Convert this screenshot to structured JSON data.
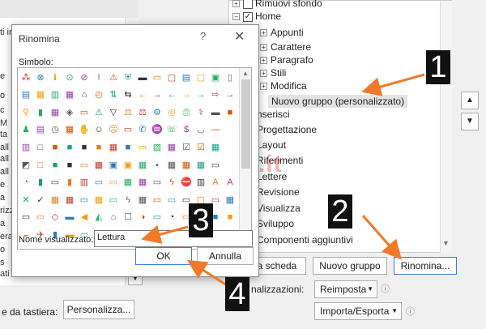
{
  "left_panel": {
    "clipped_text": [
      "ti in",
      "e",
      "o",
      "c",
      "M",
      "ta",
      "all",
      "all",
      "all",
      "e",
      "a",
      "rizz",
      "a",
      "era",
      "o",
      "s",
      "ati"
    ]
  },
  "tree": {
    "rows": [
      {
        "label": "Rimuovi sfondo",
        "expander": "+",
        "checkbox": ""
      },
      {
        "label": "Home",
        "expander": "−",
        "checkbox": "✓"
      },
      {
        "label": "Appunti",
        "expander": "+",
        "checkbox": ""
      },
      {
        "label": "Carattere",
        "expander": "+",
        "checkbox": ""
      },
      {
        "label": "Paragrafo",
        "expander": "+",
        "checkbox": ""
      },
      {
        "label": "Stili",
        "expander": "+",
        "checkbox": ""
      },
      {
        "label": "Modifica",
        "expander": "+",
        "checkbox": ""
      },
      {
        "label": "Nuovo gruppo (personalizzato)",
        "expander": "",
        "checkbox": ""
      },
      {
        "label": "nserisci",
        "expander": "",
        "checkbox": ""
      },
      {
        "label": "Progettazione",
        "expander": "",
        "checkbox": ""
      },
      {
        "label": "Layout",
        "expander": "",
        "checkbox": ""
      },
      {
        "label": "Riferimenti",
        "expander": "",
        "checkbox": ""
      },
      {
        "label": "Lettere",
        "expander": "",
        "checkbox": ""
      },
      {
        "label": "Revisione",
        "expander": "",
        "checkbox": ""
      },
      {
        "label": "Visualizza",
        "expander": "",
        "checkbox": ""
      },
      {
        "label": "Sviluppo",
        "expander": "",
        "checkbox": ""
      },
      {
        "label": "Componenti aggiuntivi",
        "expander": "",
        "checkbox": ""
      }
    ]
  },
  "buttons": {
    "new_tab": "a scheda",
    "new_group": "Nuovo gruppo",
    "rename": "Rinomina...",
    "reset": "Reimposta",
    "import_export": "Importa/Esporta",
    "customize": "Personalizza...",
    "move_up": "▲",
    "move_down": "▼"
  },
  "labels": {
    "customizations": "nalizzazioni:",
    "keyboard": "e da tastiera:",
    "info": "ⓘ"
  },
  "dialog": {
    "title": "Rinomina",
    "help": "?",
    "close": "✕",
    "symbol_label": "Simbolo:",
    "display_name_label": "Nome visualizzato:",
    "display_name_value": "Lettura",
    "ok": "OK",
    "cancel": "Annulla"
  },
  "callouts": [
    "1",
    "2",
    "3",
    "4"
  ],
  "watermark": "techpedia.it",
  "colors": {
    "arrow": "#f07a2a",
    "callout_bg": "#111111",
    "selection": "#e3e3e3"
  },
  "icon_rows": [
    [
      "⁂",
      "⊗",
      "ℹ",
      "⊙",
      "⊘",
      "!",
      "⚠",
      "⛨",
      "▬",
      "▭",
      "▢",
      "▤",
      "▢",
      "▣",
      "▯",
      "☐"
    ],
    [
      "▤",
      "▦",
      "▥",
      "▦",
      "⌂",
      "◴",
      "⇅",
      "⇆",
      "←",
      "→",
      "←",
      "→",
      "→",
      "⇨",
      "→",
      "☐"
    ],
    [
      "⚲",
      "▮",
      "▦",
      "◈",
      "▭",
      "⚠",
      "▽",
      "⚖",
      "⚖",
      "⚙",
      "◎",
      "⎙",
      "⚕",
      "▬",
      "■",
      "☐"
    ],
    [
      "♟",
      "▤",
      "◷",
      "▦",
      "✋",
      "☺",
      "☹",
      "▭",
      "✆",
      "♒",
      "☏",
      "$",
      "◡",
      "—",
      "",
      ""
    ],
    [
      "▥",
      "□",
      "■",
      "■",
      "■",
      "■",
      "▦",
      "■",
      "▭",
      "▨",
      "▦",
      "☑",
      "☑",
      "▦",
      "",
      ""
    ],
    [
      "◩",
      "□",
      "■",
      "■",
      "▭",
      "▦",
      "▣",
      "▣",
      "▦",
      "▪",
      "▦",
      "▦",
      "▦",
      "▭",
      "",
      ""
    ],
    [
      "◔",
      "▮",
      "▭",
      "▮",
      "▥",
      "▭",
      "▭",
      "▦",
      "▦",
      "▭",
      "ϟ",
      "⛔",
      "▥",
      "A",
      "A",
      ""
    ],
    [
      "✕",
      "✓",
      "▦",
      "▦",
      "▭",
      "▦",
      "▭",
      "ϟ",
      "▦",
      "▭",
      "▭",
      "▭",
      "▢",
      "▭",
      "▦",
      ""
    ],
    [
      "▭",
      "▭",
      "◇",
      "▬",
      "◀",
      "◭",
      "⌂",
      "☐",
      "◑",
      "▭",
      "◔",
      "▭",
      "■",
      "■",
      "■",
      ""
    ],
    [
      "◒",
      "✈",
      "▮",
      "▬",
      "▭",
      "▭",
      "▭",
      "◇",
      "▭",
      "▭",
      "▭",
      "↩",
      "▭",
      "▬",
      "",
      ""
    ]
  ]
}
